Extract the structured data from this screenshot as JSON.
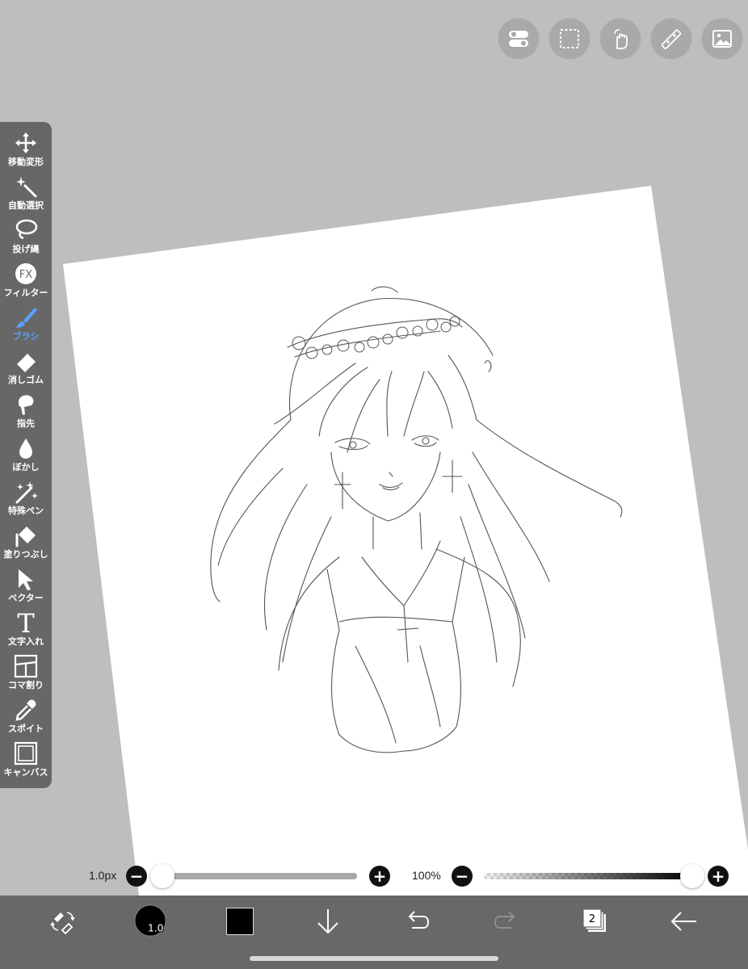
{
  "top_toolbar": {
    "buttons": [
      {
        "icon": "toggle-settings-icon"
      },
      {
        "icon": "selection-icon"
      },
      {
        "icon": "touch-gesture-icon"
      },
      {
        "icon": "ruler-icon"
      },
      {
        "icon": "image-material-icon"
      }
    ]
  },
  "left_toolbar": {
    "tools": [
      {
        "label": "移動変形",
        "icon": "move-transform-icon",
        "active": false
      },
      {
        "label": "自動選択",
        "icon": "magic-wand-icon",
        "active": false
      },
      {
        "label": "投げ縄",
        "icon": "lasso-icon",
        "active": false
      },
      {
        "label": "フィルター",
        "icon": "fx-filter-icon",
        "active": false
      },
      {
        "label": "ブラシ",
        "icon": "brush-icon",
        "active": true
      },
      {
        "label": "消しゴム",
        "icon": "eraser-icon",
        "active": false
      },
      {
        "label": "指先",
        "icon": "smudge-icon",
        "active": false
      },
      {
        "label": "ぼかし",
        "icon": "blur-drop-icon",
        "active": false
      },
      {
        "label": "特殊ペン",
        "icon": "special-pen-icon",
        "active": false
      },
      {
        "label": "塗りつぶし",
        "icon": "bucket-fill-icon",
        "active": false
      },
      {
        "label": "ベクター",
        "icon": "vector-cursor-icon",
        "active": false
      },
      {
        "label": "文字入れ",
        "icon": "text-icon",
        "active": false
      },
      {
        "label": "コマ割り",
        "icon": "panel-split-icon",
        "active": false
      },
      {
        "label": "スポイト",
        "icon": "eyedropper-icon",
        "active": false
      },
      {
        "label": "キャンバス",
        "icon": "canvas-icon",
        "active": false
      }
    ],
    "active_color": "#5aa0ff"
  },
  "brush_size": {
    "value_label": "1.0px",
    "minus": "−",
    "plus": "+",
    "level": 0.0
  },
  "opacity": {
    "value_label": "100%",
    "minus": "−",
    "plus": "+",
    "level": 1.0
  },
  "bottom_bar": {
    "brush_size_badge": "1.0",
    "current_color": "#000000",
    "layer_count": "2",
    "items": [
      {
        "icon": "swap-pen-eraser-icon"
      },
      {
        "icon": "brush-size-icon"
      },
      {
        "icon": "color-swatch-icon"
      },
      {
        "icon": "download-arrow-icon"
      },
      {
        "icon": "undo-icon"
      },
      {
        "icon": "redo-icon"
      },
      {
        "icon": "layers-icon"
      },
      {
        "icon": "back-arrow-icon"
      }
    ]
  },
  "colors": {
    "background": "#bebebe",
    "toolbar": "#676767",
    "bottom_bar": "#686868",
    "top_button": "#a9a9a9"
  }
}
